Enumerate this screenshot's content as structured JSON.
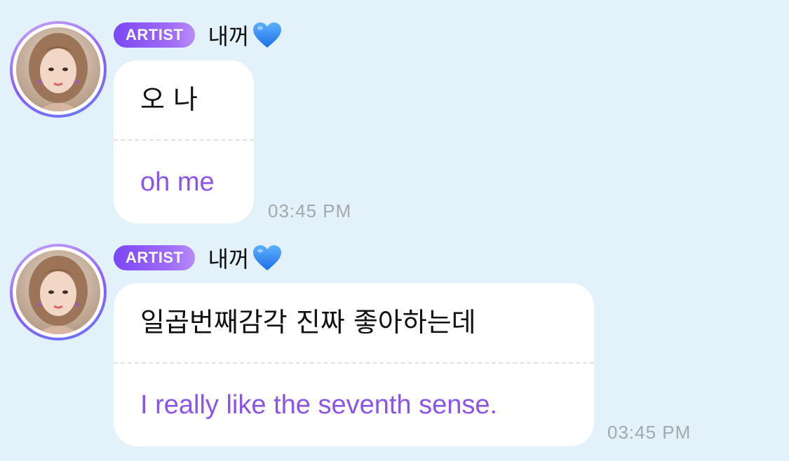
{
  "messages": [
    {
      "badge": "ARTIST",
      "sender": "내꺼",
      "sender_emoji_icon": "blue-heart-icon",
      "original": "오 나",
      "translation": "oh me",
      "time": "03:45 PM"
    },
    {
      "badge": "ARTIST",
      "sender": "내꺼",
      "sender_emoji_icon": "blue-heart-icon",
      "original": "일곱번째감각 진짜 좋아하는데",
      "translation": "I really like the seventh sense.",
      "time": "03:45 PM"
    }
  ],
  "colors": {
    "background": "#e3f2fa",
    "badge": "#8b5cf6",
    "translation_text": "#8a55e8",
    "timestamp": "#a3a8ad"
  }
}
